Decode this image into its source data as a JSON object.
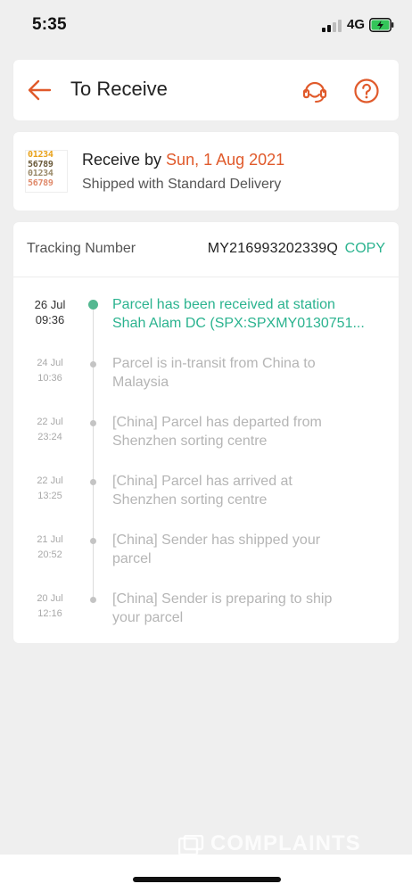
{
  "status_bar": {
    "time": "5:35",
    "network": "4G"
  },
  "header": {
    "title": "To Receive",
    "back_icon": "back-arrow-icon",
    "support_icon": "headset-icon",
    "help_icon": "help-circle-icon",
    "accent_color": "#e05a2b"
  },
  "delivery": {
    "receive_prefix": "Receive by ",
    "receive_date": "Sun, 1 Aug 2021",
    "shipping_method": "Shipped with Standard Delivery",
    "thumbnail_lines": [
      "01234",
      "56789",
      "01234",
      "56789"
    ]
  },
  "tracking": {
    "label": "Tracking Number",
    "number": "MY216993202339Q",
    "copy_label": "COPY",
    "accent_color": "#2bb38f",
    "events": [
      {
        "date": "26 Jul",
        "time": "09:36",
        "line1": "Parcel has been received at station",
        "line2": "Shah Alam DC (SPX:SPXMY0130751...",
        "active": true
      },
      {
        "date": "24 Jul",
        "time": "10:36",
        "line1": "Parcel is in-transit from China to",
        "line2": "Malaysia",
        "active": false
      },
      {
        "date": "22 Jul",
        "time": "23:24",
        "line1": "[China] Parcel has departed from",
        "line2": "Shenzhen sorting centre",
        "active": false
      },
      {
        "date": "22 Jul",
        "time": "13:25",
        "line1": "[China] Parcel has arrived at",
        "line2": "Shenzhen sorting centre",
        "active": false
      },
      {
        "date": "21 Jul",
        "time": "20:52",
        "line1": "[China] Sender has shipped your",
        "line2": "parcel",
        "active": false
      },
      {
        "date": "20 Jul",
        "time": "12:16",
        "line1": "[China] Sender is preparing to ship",
        "line2": "your parcel",
        "active": false
      }
    ]
  },
  "watermark": {
    "text": "COMPLAINTS"
  }
}
